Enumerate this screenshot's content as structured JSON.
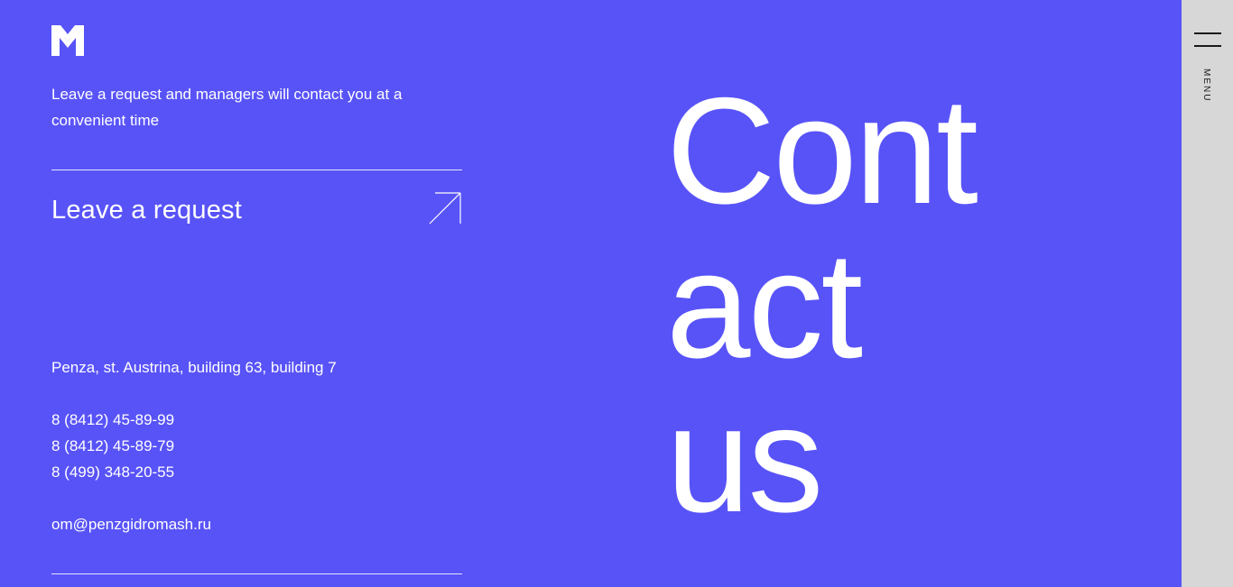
{
  "brand": {
    "logo_icon": "pgm-logo-icon"
  },
  "colors": {
    "background": "#5853f7",
    "sidebar": "#d7d7d7",
    "text": "#ffffff"
  },
  "contact": {
    "intro": "Leave a request and managers will contact you at a convenient time",
    "request_label": "Leave a request",
    "request_icon": "arrow-up-right-icon",
    "address": "Penza, st. Austrina, building 63, building 7",
    "phones": [
      "8 (8412) 45-89-99",
      "8 (8412) 45-89-79",
      "8 (499) 348-20-55"
    ],
    "email": "om@penzgidromash.ru"
  },
  "headline": {
    "lines": [
      "Cont",
      "act",
      "us"
    ]
  },
  "sidebar": {
    "menu_label": "MENU",
    "menu_icon": "hamburger-icon"
  }
}
